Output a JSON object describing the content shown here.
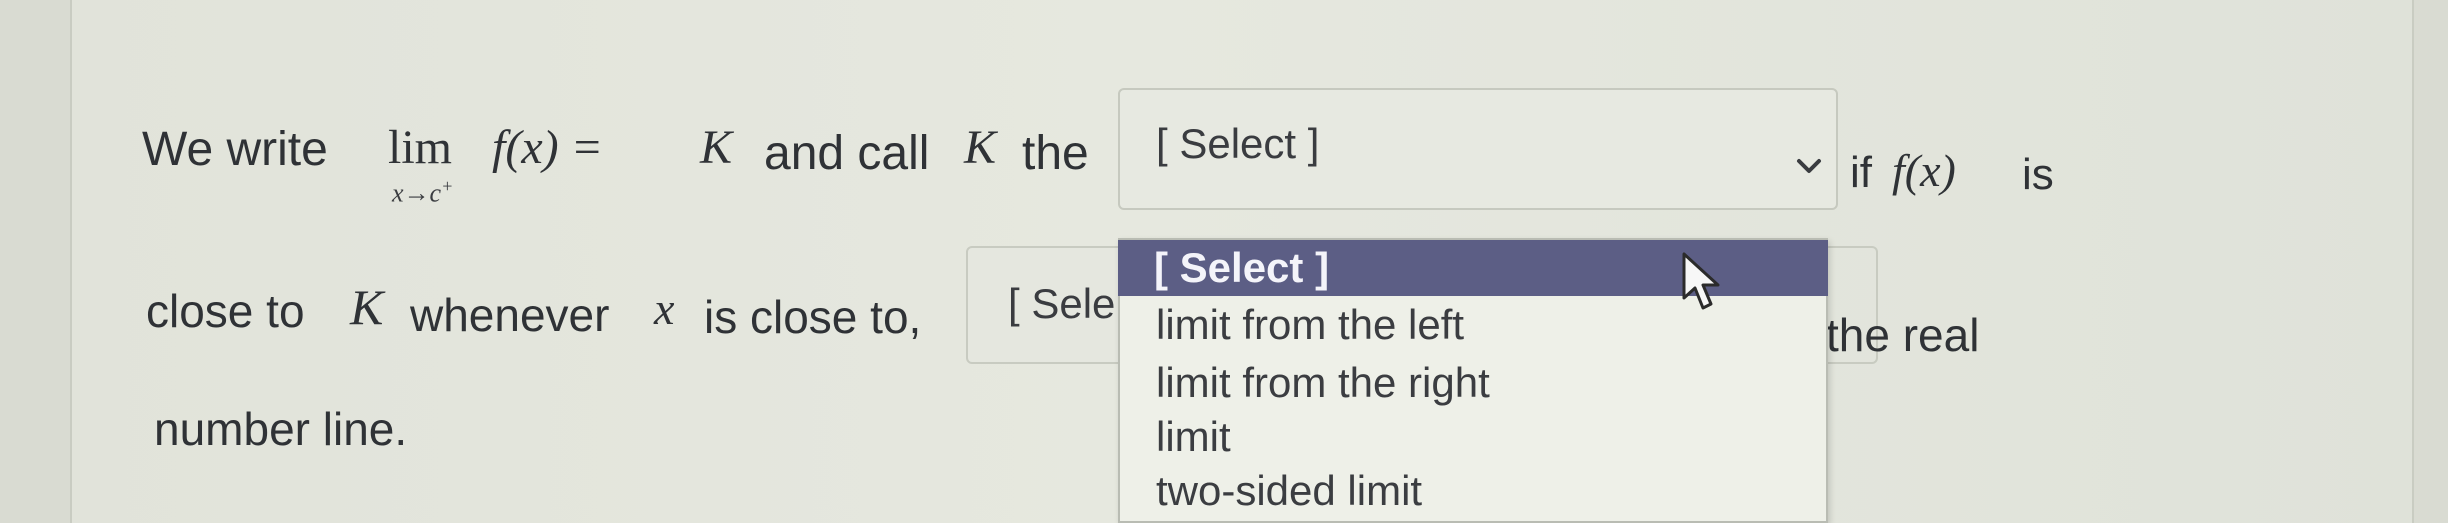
{
  "sentence": {
    "line1_part1": "We write",
    "lim": "lim",
    "lim_sub": "x→c",
    "lim_sub_sup": "+",
    "fx_eq": "f(x) = ",
    "K1": "K",
    "and_call": "and call",
    "K2": "K",
    "the": "the",
    "if": "if",
    "fx2": "f(x)",
    "is": "is",
    "line2_part1": "close to",
    "K3": "K",
    "whenever": "whenever",
    "x": "x",
    "is_close_to": "is close to,",
    "the_real": "the real",
    "line3": "number line."
  },
  "select_main": {
    "value": "[ Select ]"
  },
  "select_second": {
    "value": "[ Sele"
  },
  "dropdown": {
    "options": [
      "[ Select ]",
      "limit from the left",
      "limit from the right",
      "limit",
      "two-sided limit"
    ],
    "highlighted_index": 0
  },
  "colors": {
    "highlight_bg": "#5c5e85",
    "highlight_text": "#f4f4fa",
    "text": "#2f3236",
    "panel_bg": "#e4e6dd"
  },
  "icons": {
    "chevron": "chevron-down-icon",
    "cursor": "mouse-pointer-icon"
  }
}
